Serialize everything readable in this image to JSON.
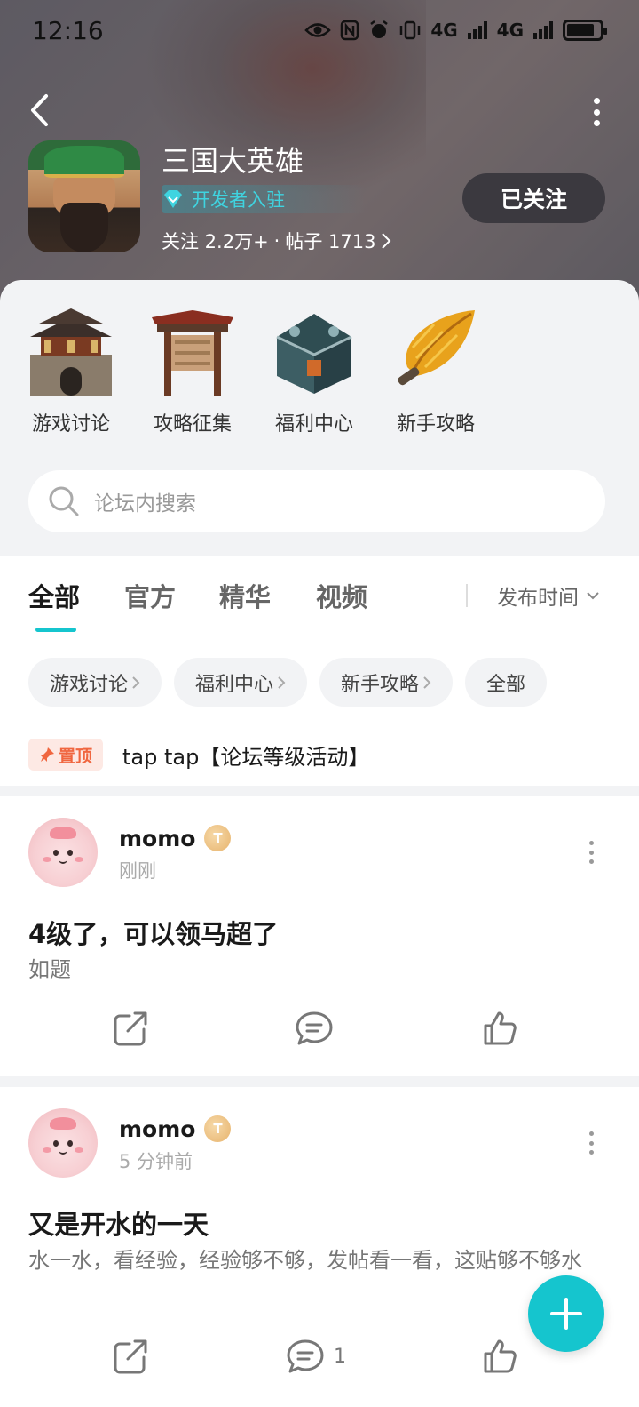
{
  "status_bar": {
    "time": "12:16",
    "network_1": "4G",
    "network_2": "4G"
  },
  "header": {
    "game_title": "三国大英雄",
    "dev_badge": "开发者入驻",
    "stats_follow": "关注 2.2万+",
    "stats_sep": "·",
    "stats_posts": "帖子 1713",
    "follow_button": "已关注"
  },
  "categories": [
    {
      "label": "游戏讨论",
      "icon": "city-gate-icon"
    },
    {
      "label": "攻略征集",
      "icon": "notice-board-icon"
    },
    {
      "label": "福利中心",
      "icon": "treasure-chest-icon"
    },
    {
      "label": "新手攻略",
      "icon": "feather-fan-icon"
    }
  ],
  "search": {
    "placeholder": "论坛内搜索"
  },
  "tabs": [
    {
      "label": "全部",
      "active": true
    },
    {
      "label": "官方",
      "active": false
    },
    {
      "label": "精华",
      "active": false
    },
    {
      "label": "视频",
      "active": false
    }
  ],
  "sort": {
    "label": "发布时间"
  },
  "chips": [
    {
      "label": "游戏讨论",
      "arrow": true
    },
    {
      "label": "福利中心",
      "arrow": true
    },
    {
      "label": "新手攻略",
      "arrow": true
    },
    {
      "label": "全部",
      "arrow": false
    }
  ],
  "pinned": {
    "badge": "置顶",
    "text": "tap tap【论坛等级活动】"
  },
  "posts": [
    {
      "username": "momo",
      "level_badge": "T",
      "time": "刚刚",
      "title": "4级了，可以领马超了",
      "body": "如题",
      "comment_count": ""
    },
    {
      "username": "momo",
      "level_badge": "T",
      "time": "5 分钟前",
      "title": "又是开水的一天",
      "body": "水一水，看经验，经验够不够，发帖看一看，这贴够不够水",
      "comment_count": "1"
    }
  ],
  "colors": {
    "accent": "#15c5ce",
    "pin_red": "#f0663f",
    "dev_cyan": "#3fd4e0"
  }
}
